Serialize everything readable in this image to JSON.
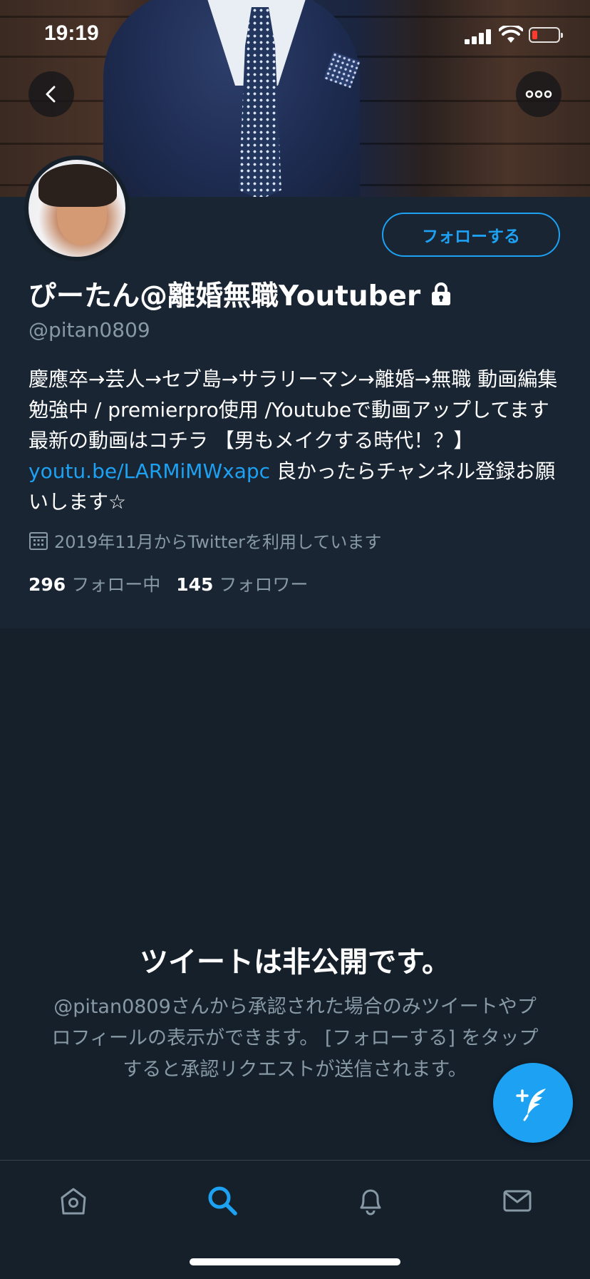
{
  "status_bar": {
    "time": "19:19"
  },
  "header": {
    "back_icon": "chevron-left-icon",
    "more_icon": "ellipsis-icon"
  },
  "profile": {
    "follow_label": "フォローする",
    "display_name": "ぴーたん@離婚無職Youtuber",
    "handle": "@pitan0809",
    "bio_text": "慶應卒→芸人→セブ島→サラリーマン→離婚→無職 動画編集勉強中 / premierpro使用 /Youtubeで動画アップしてます 最新の動画はコチラ 【男もメイクする時代！？】 ",
    "bio_link": "youtu.be/LARMiMWxapc",
    "bio_suffix": " 良かったらチャンネル登録お願いします☆",
    "joined": "2019年11月からTwitterを利用しています",
    "following_count": "296",
    "following_label": "フォロー中",
    "followers_count": "145",
    "followers_label": "フォロワー"
  },
  "protected": {
    "title": "ツイートは非公開です。",
    "description": "@pitan0809さんから承認された場合のみツイートやプロフィールの表示ができます。 [フォローする] をタップすると承認リクエストが送信されます。"
  },
  "tabbar": {
    "items": [
      {
        "name": "home",
        "icon": "home-icon"
      },
      {
        "name": "search",
        "icon": "search-icon",
        "active": true
      },
      {
        "name": "notifications",
        "icon": "bell-icon"
      },
      {
        "name": "messages",
        "icon": "mail-icon"
      }
    ]
  },
  "colors": {
    "accent": "#1da1f2",
    "background": "#15202b",
    "profile_background": "#192533",
    "secondary_text": "#8899a6",
    "battery_low": "#ff3b30"
  }
}
